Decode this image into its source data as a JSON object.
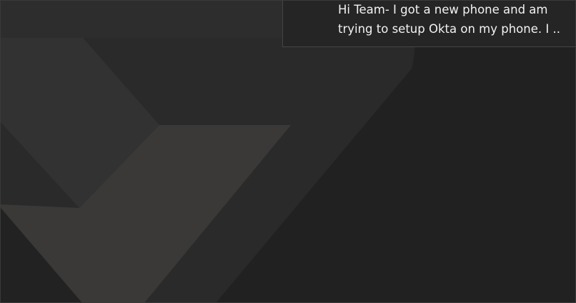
{
  "notification": {
    "message_line_1": "Hi Team- I got a new phone and am",
    "message_line_2": "trying to setup Okta on my phone. I ..."
  },
  "colors": {
    "background": "#212121",
    "shape_light": "#2a2a2a",
    "shape_mid": "#333333",
    "shape_warm": "#3a3937",
    "toast_background": "#252525",
    "toast_border": "#454545",
    "text": "#f2f2f2"
  },
  "icons": {
    "wallpaper": "geometric-chevron-logo"
  }
}
